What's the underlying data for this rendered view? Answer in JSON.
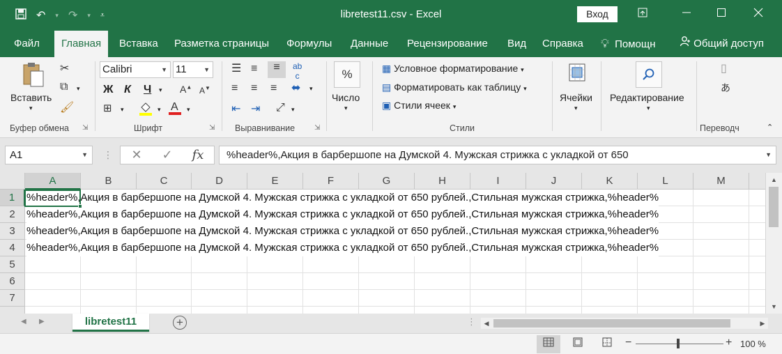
{
  "app": {
    "title": "libretest11.csv  -  Excel",
    "signin_label": "Вход",
    "brand_color": "#217346"
  },
  "window_controls": {
    "ribbon_options_icon": "ribbon-display-icon",
    "minimize_icon": "minimize-icon",
    "maximize_icon": "maximize-icon",
    "close_icon": "close-icon"
  },
  "quick_access": {
    "save_icon": "save-icon",
    "undo_icon": "undo-icon",
    "redo_icon": "redo-icon",
    "customize_icon": "customize-icon"
  },
  "ribbon_tabs": [
    {
      "label": "Файл",
      "active": false
    },
    {
      "label": "Главная",
      "active": true
    },
    {
      "label": "Вставка",
      "active": false
    },
    {
      "label": "Разметка страницы",
      "active": false
    },
    {
      "label": "Формулы",
      "active": false
    },
    {
      "label": "Данные",
      "active": false
    },
    {
      "label": "Рецензирование",
      "active": false
    },
    {
      "label": "Вид",
      "active": false
    },
    {
      "label": "Справка",
      "active": false
    }
  ],
  "tell_me": {
    "label": "Помощн",
    "icon": "lightbulb-icon"
  },
  "share": {
    "label": "Общий доступ",
    "icon": "share-person-icon"
  },
  "ribbon": {
    "clipboard": {
      "label": "Буфер обмена",
      "paste_label": "Вставить"
    },
    "font": {
      "label": "Шрифт",
      "font_name": "Calibri",
      "font_size": "11",
      "bold": "Ж",
      "italic": "К",
      "underline": "Ч"
    },
    "alignment": {
      "label": "Выравнивание"
    },
    "number": {
      "label": "Число",
      "icon_glyph": "%"
    },
    "styles": {
      "label": "Стили",
      "conditional_formatting": "Условное форматирование",
      "format_as_table": "Форматировать как таблицу",
      "cell_styles": "Стили ячеек"
    },
    "cells": {
      "label": "Ячейки"
    },
    "editing": {
      "label": "Редактирование"
    },
    "translate": {
      "label": "Переводч"
    }
  },
  "formula_bar": {
    "name_box": "A1",
    "fx_label": "fx",
    "formula": "%header%,Акция в барбершопе на Думской 4. Мужская стрижка с укладкой от 650"
  },
  "grid": {
    "columns": [
      "A",
      "B",
      "C",
      "D",
      "E",
      "F",
      "G",
      "H",
      "I",
      "J",
      "K",
      "L",
      "M"
    ],
    "rows": [
      "1",
      "2",
      "3",
      "4",
      "5",
      "6",
      "7"
    ],
    "cells": [
      "%header%,Акция в барбершопе на Думской 4. Мужская стрижка с укладкой от 650 рублей.,Стильная мужская стрижка,%header%",
      "%header%,Акция в барбершопе на Думской 4. Мужская стрижка с укладкой от 650 рублей.,Стильная мужская стрижка,%header%",
      "%header%,Акция в барбершопе на Думской 4. Мужская стрижка с укладкой от 650 рублей.,Стильная мужская стрижка,%header%",
      "%header%,Акция в барбершопе на Думской 4. Мужская стрижка с укладкой от 650 рублей.,Стильная мужская стрижка,%header%"
    ],
    "selected_cell": "A1"
  },
  "sheets": {
    "tabs": [
      "libretest11"
    ],
    "add_icon": "add-sheet-icon"
  },
  "status_bar": {
    "zoom": "100 %",
    "zoom_out": "−",
    "zoom_in": "+",
    "view": "normal"
  }
}
